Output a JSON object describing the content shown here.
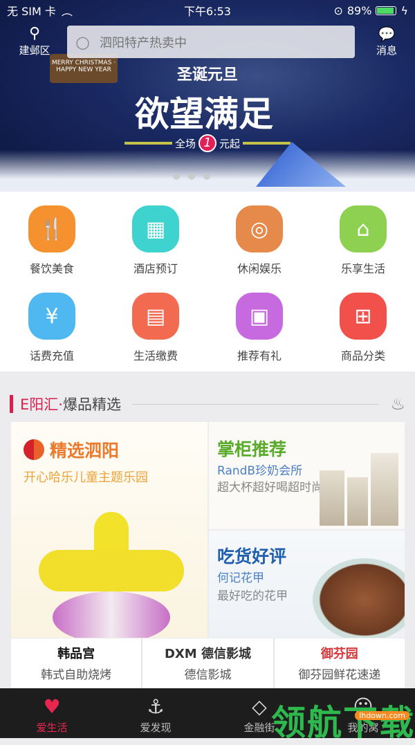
{
  "status": {
    "carrier": "无 SIM 卡",
    "time": "下午6:53",
    "battery": "89%",
    "battery_level": 0.89
  },
  "header": {
    "location": "建邺区",
    "search_placeholder": "泗阳特产热卖中",
    "messages": "消息"
  },
  "banner": {
    "tagline": "圣诞元旦",
    "headline": "欲望满足",
    "offer_prefix": "全场",
    "offer_number": "1",
    "offer_suffix": "元起",
    "sign": "MERRY CHRISTMAS · HAPPY NEW YEAR",
    "slide_count": 3
  },
  "categories": [
    {
      "label": "餐饮美食",
      "icon": "utensils-icon",
      "color": "#f5922f",
      "glyph": "🍴"
    },
    {
      "label": "酒店预订",
      "icon": "hotel-icon",
      "color": "#3fd3cf",
      "glyph": "▦"
    },
    {
      "label": "休闲娱乐",
      "icon": "film-reel-icon",
      "color": "#e68a4c",
      "glyph": "◎"
    },
    {
      "label": "乐享生活",
      "icon": "home-smile-icon",
      "color": "#8ed150",
      "glyph": "⌂"
    },
    {
      "label": "话费充值",
      "icon": "phone-yen-icon",
      "color": "#4fb8f0",
      "glyph": "¥"
    },
    {
      "label": "生活缴费",
      "icon": "bill-icon",
      "color": "#f26a50",
      "glyph": "▤"
    },
    {
      "label": "推荐有礼",
      "icon": "gift-icon",
      "color": "#c76ae0",
      "glyph": "▣"
    },
    {
      "label": "商品分类",
      "icon": "grid-icon",
      "color": "#f2514b",
      "glyph": "⊞"
    }
  ],
  "section": {
    "brand": "E阳汇·",
    "title": "爆品精选"
  },
  "featured": {
    "left": {
      "title": "精选泗阳",
      "subtitle": "开心哈乐儿童主题乐园"
    },
    "top_right": {
      "title": "掌柜推荐",
      "name": "RandB珍奶会所",
      "desc": "超大杯超好喝超时尚"
    },
    "bottom_right": {
      "title": "吃货好评",
      "name": "何记花甲",
      "desc": "最好吃的花甲"
    }
  },
  "brands": [
    {
      "logo": "韩品宫",
      "label": "韩式自助烧烤"
    },
    {
      "logo": "DXM 德信影城",
      "label": "德信影城"
    },
    {
      "logo": "御芬园",
      "label": "御芬园鲜花速递"
    }
  ],
  "tabs": [
    {
      "label": "爱生活",
      "glyph": "♥",
      "active": true
    },
    {
      "label": "爱发现",
      "glyph": "⚓"
    },
    {
      "label": "金融街",
      "glyph": "◇"
    },
    {
      "label": "我的窝",
      "glyph": "☺"
    }
  ],
  "watermark": {
    "text": "领航下载",
    "url": "lhdown.com"
  }
}
